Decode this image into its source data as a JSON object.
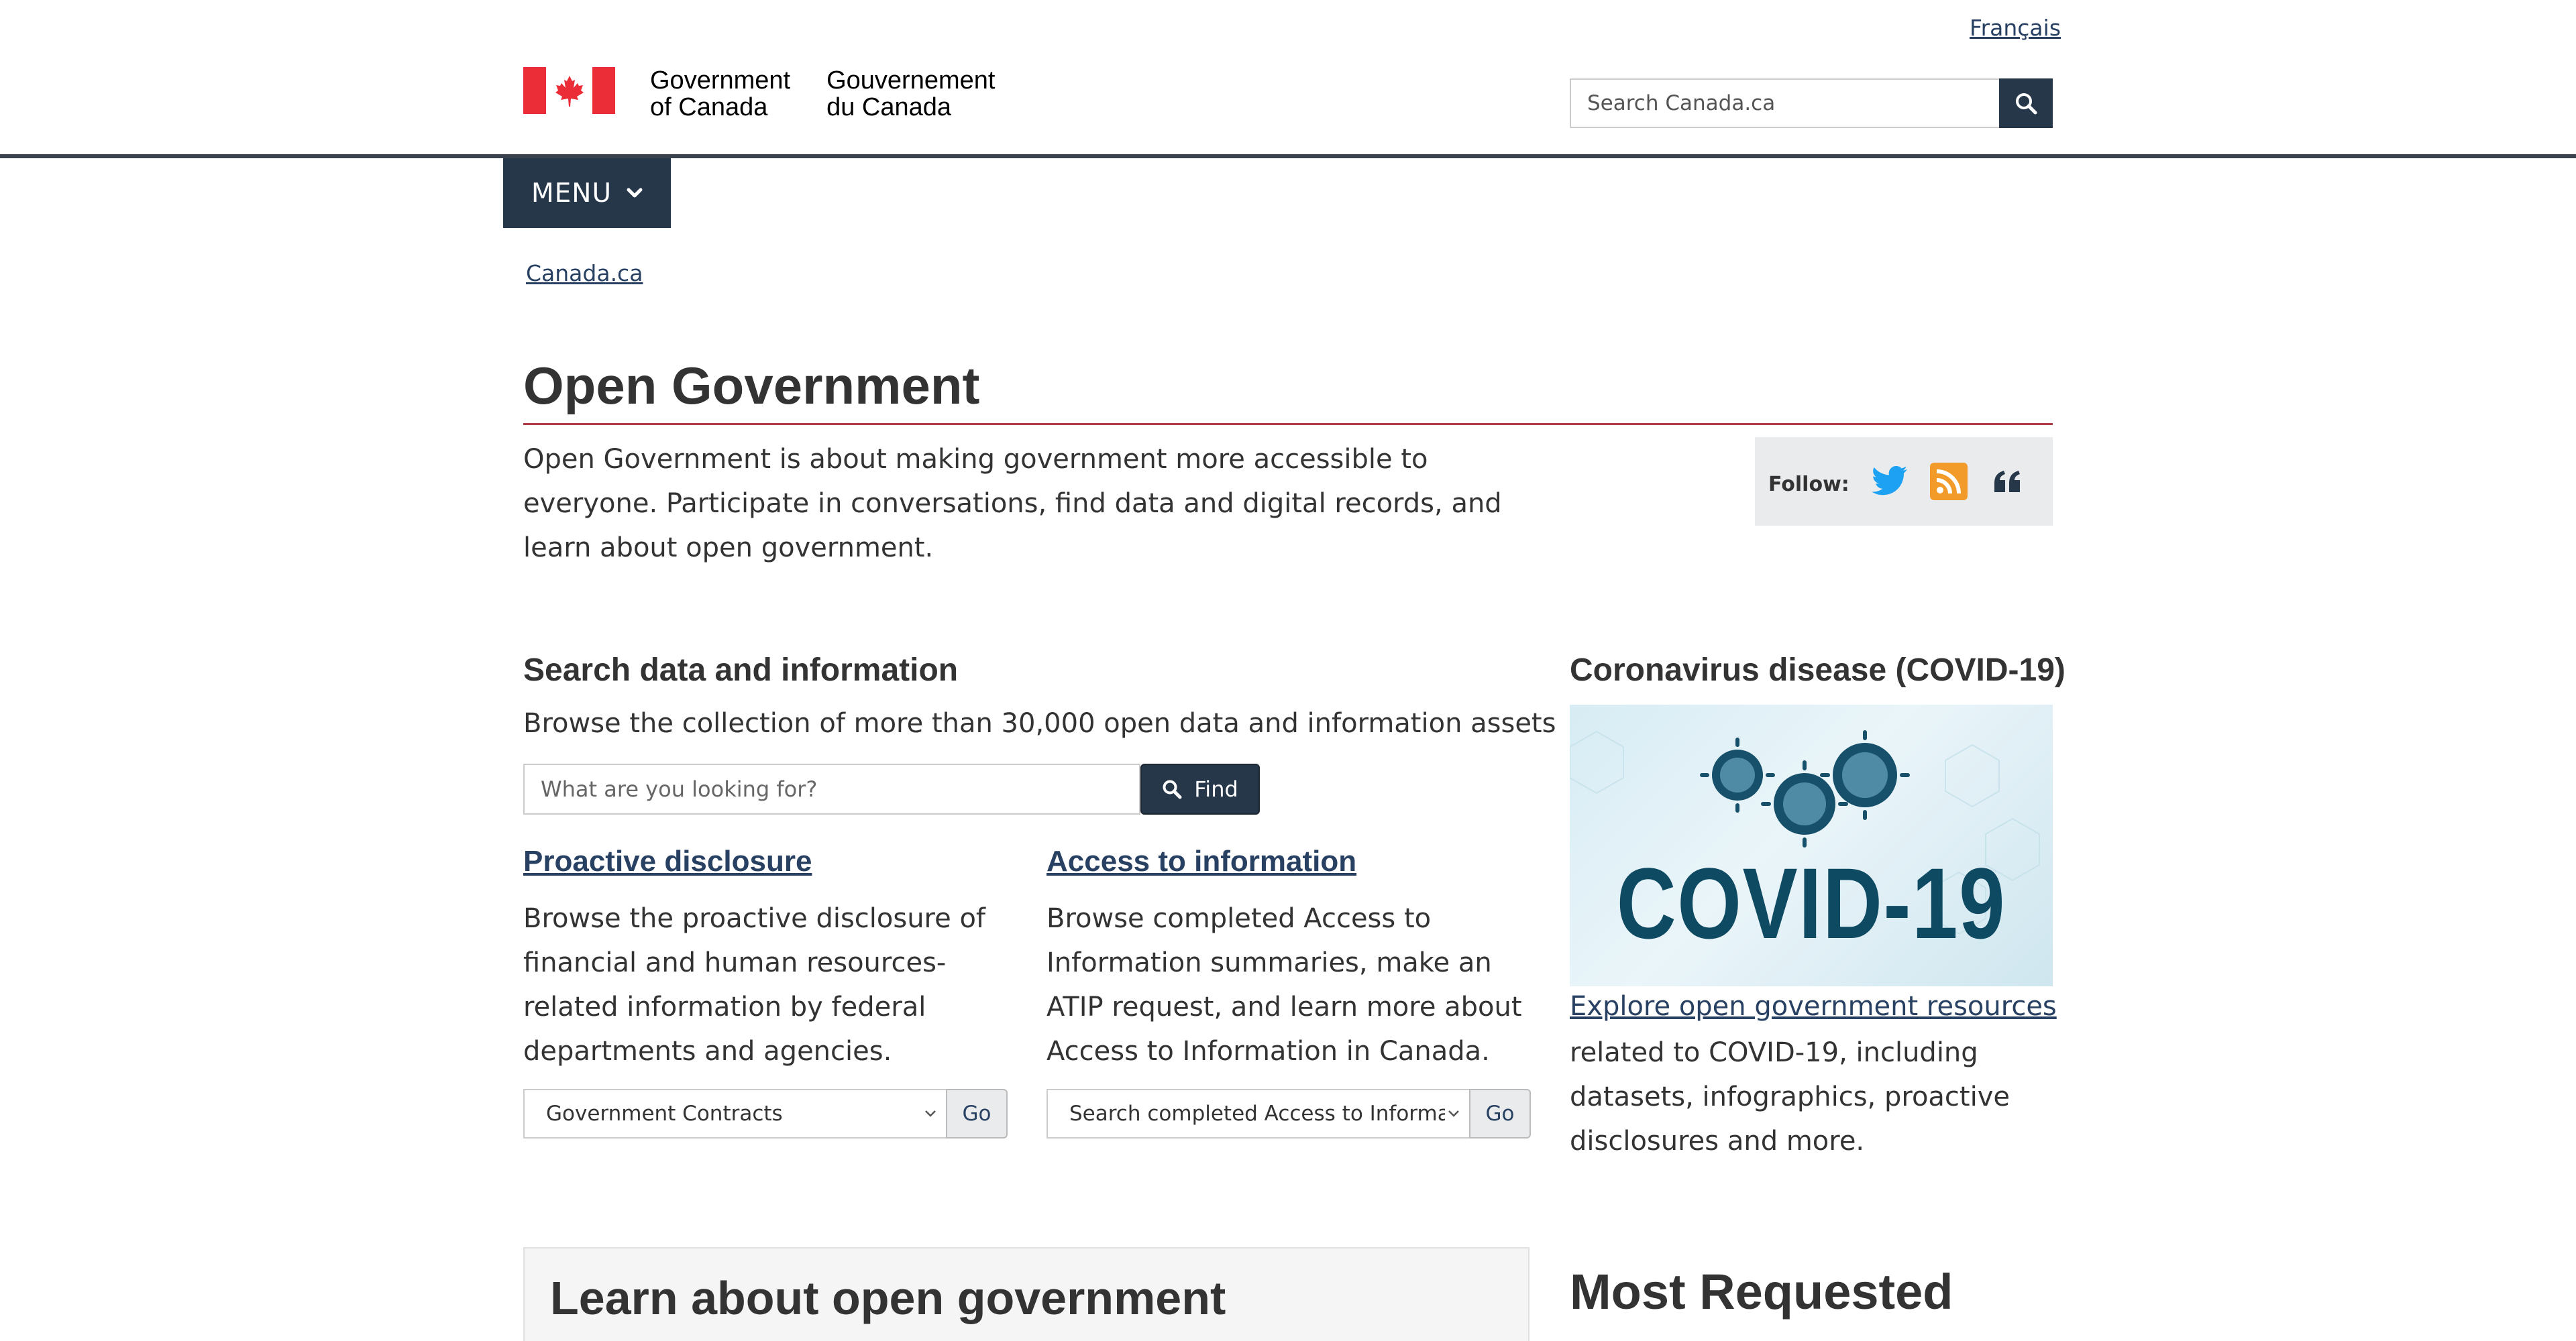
{
  "header": {
    "language_link": "Français",
    "wordmark_en_line1": "Government",
    "wordmark_en_line2": "of Canada",
    "wordmark_fr_line1": "Gouvernement",
    "wordmark_fr_line2": "du Canada",
    "search_placeholder": "Search Canada.ca",
    "menu_label": "MENU"
  },
  "breadcrumb": {
    "items": [
      "Canada.ca"
    ]
  },
  "page": {
    "title": "Open Government",
    "intro": "Open Government is about making government more accessible to everyone. Participate in conversations, find data and digital records, and learn about open government."
  },
  "follow": {
    "label": "Follow:",
    "icons": [
      "twitter-icon",
      "rss-icon",
      "quote-icon"
    ]
  },
  "search_section": {
    "heading": "Search data and information",
    "description": "Browse the collection of more than 30,000 open data and information assets",
    "input_placeholder": "What are you looking for?",
    "find_label": "Find"
  },
  "proactive": {
    "heading": "Proactive disclosure",
    "text": "Browse the proactive disclosure of financial and human resources-related information by federal departments and agencies.",
    "selected": "Government Contracts",
    "go_label": "Go"
  },
  "ati": {
    "heading": "Access to information",
    "text": "Browse completed Access to Information summaries, make an ATIP request, and learn more about Access to Information in Canada.",
    "selected": "Search completed Access to Information requests",
    "go_label": "Go"
  },
  "covid": {
    "heading": "Coronavirus disease (COVID-19)",
    "image_text": "COVID-19",
    "link": "Explore open government resources",
    "text": "related to COVID-19, including datasets, infographics, proactive disclosures and more."
  },
  "bottom": {
    "learn_heading": "Learn about open government",
    "most_requested_heading": "Most Requested"
  },
  "colors": {
    "primary": "#26374a",
    "link": "#284162",
    "flag_red": "#eb2d37",
    "title_rule": "#af3c43"
  }
}
